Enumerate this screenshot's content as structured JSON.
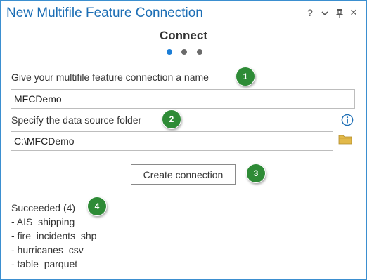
{
  "window": {
    "title": "New Multifile Feature Connection",
    "controls": {
      "help": "?",
      "options": "⌄",
      "pin": "pin-icon",
      "close": "×"
    }
  },
  "wizard": {
    "step_title": "Connect",
    "steps_total": 3,
    "current_step": 1
  },
  "name_field": {
    "label": "Give your multifile feature connection a name",
    "value": "MFCDemo"
  },
  "folder_field": {
    "label": "Specify the data source folder",
    "value": "C:\\MFCDemo",
    "info_icon": "info-icon",
    "browse_icon": "folder-icon"
  },
  "create_button": {
    "label": "Create connection"
  },
  "results": {
    "header": "Succeeded (4)",
    "items": [
      "- AIS_shipping",
      "- fire_incidents_shp",
      "- hurricanes_csv",
      "- table_parquet"
    ]
  },
  "callouts": [
    "1",
    "2",
    "3",
    "4"
  ],
  "colors": {
    "title": "#1c6eb5",
    "border": "#3b8fd0",
    "callout": "#2e8b36",
    "active_dot": "#1c7ed6",
    "folder": "#e2b94a"
  }
}
